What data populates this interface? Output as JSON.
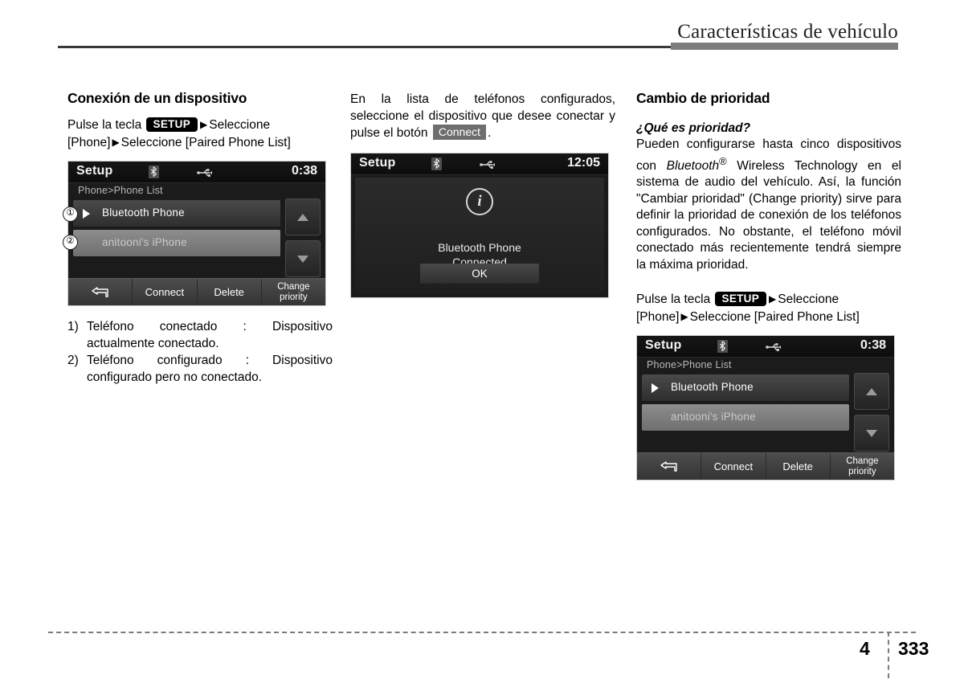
{
  "header": {
    "title": "Características de vehículo"
  },
  "left_column": {
    "section_title": "Conexión de un dispositivo",
    "instruction": {
      "prefix": "Pulse la tecla",
      "setup_badge": "SETUP",
      "arrow": "▶",
      "after_badge": "Seleccione",
      "line2_a": "[Phone]",
      "line2_b": "Seleccione [Paired Phone List]"
    },
    "device_screen": {
      "title": "Setup",
      "clock": "0:38",
      "breadcrumb": "Phone>Phone List",
      "bluetooth_icon": "bluetooth-icon",
      "usb_icon": "usb-icon",
      "rows": [
        {
          "label": "Bluetooth Phone",
          "state": "connected"
        },
        {
          "label": "anitooni's iPhone",
          "state": "paired"
        }
      ],
      "scroll_up_icon": "chevron-up-icon",
      "scroll_down_icon": "chevron-down-icon",
      "buttons": [
        {
          "label": "",
          "icon": "back-arrow-icon"
        },
        {
          "label": "Connect",
          "icon": ""
        },
        {
          "label": "Delete",
          "icon": ""
        },
        {
          "label": "Change\npriority",
          "line1": "Change",
          "line2": "priority",
          "icon": ""
        }
      ]
    },
    "callouts": [
      {
        "number": "①"
      },
      {
        "number": "②"
      }
    ],
    "numbered_notes": [
      {
        "marker": "1)",
        "line1": "Teléfono conectado : Dispositivo",
        "line2": "actualmente conectado."
      },
      {
        "marker": "2)",
        "line1": "Teléfono configurado : Dispositivo",
        "line2": "configurado pero no conectado."
      }
    ]
  },
  "middle_column": {
    "paragraph_a": "En la lista de teléfonos configurados, seleccione el dispositivo que desee conectar y pulse el botón",
    "connect_badge": "Connect",
    "paragraph_a_end": ".",
    "device_screen": {
      "title": "Setup",
      "clock": "12:05",
      "bluetooth_icon": "bluetooth-icon",
      "usb_icon": "usb-icon",
      "info_icon": "i",
      "message_line1": "Bluetooth Phone",
      "message_line2": "Connected",
      "ok_button": "OK"
    }
  },
  "right_column": {
    "section_title": "Cambio de prioridad",
    "sub_title": "¿Qué es prioridad?",
    "paragraph_1_part1": "Pueden configurarse hasta cinco dispositivos con ",
    "paragraph_1_bluetooth": "Bluetooth",
    "paragraph_1_reg": "®",
    "paragraph_1_part2": " Wireless Technology en el sistema de audio del vehículo. Así, la función \"Cambiar prioridad\" (Change priority) sirve para definir la prioridad de conexión de los teléfonos configurados. No obstante, el teléfono móvil conectado más recientemente tendrá siempre la máxima prioridad.",
    "instruction": {
      "prefix": "Pulse la tecla",
      "setup_badge": "SETUP",
      "arrow": "▶",
      "after_badge": "Seleccione",
      "line2_a": "[Phone]",
      "line2_b": "Seleccione [Paired Phone List]"
    },
    "device_screen": {
      "title": "Setup",
      "clock": "0:38",
      "breadcrumb": "Phone>Phone List",
      "bluetooth_icon": "bluetooth-icon",
      "usb_icon": "usb-icon",
      "rows": [
        {
          "label": "Bluetooth Phone",
          "state": "connected"
        },
        {
          "label": "anitooni's iPhone",
          "state": "paired"
        }
      ],
      "buttons": [
        {
          "label": "",
          "icon": "back-arrow-icon"
        },
        {
          "label": "Connect",
          "icon": ""
        },
        {
          "label": "Delete",
          "icon": ""
        },
        {
          "line1": "Change",
          "line2": "priority",
          "icon": ""
        }
      ]
    }
  },
  "footer": {
    "chapter": "4",
    "page": "333"
  },
  "colors": {
    "header_rule_thin": "#3a3a3a",
    "header_rule_thick": "#7d7d7d",
    "setup_badge_bg": "#000000",
    "connect_badge_bg": "#6e6e6e",
    "device_bg": "#1b1b1b",
    "footer_dash": "#7b7b7b"
  }
}
